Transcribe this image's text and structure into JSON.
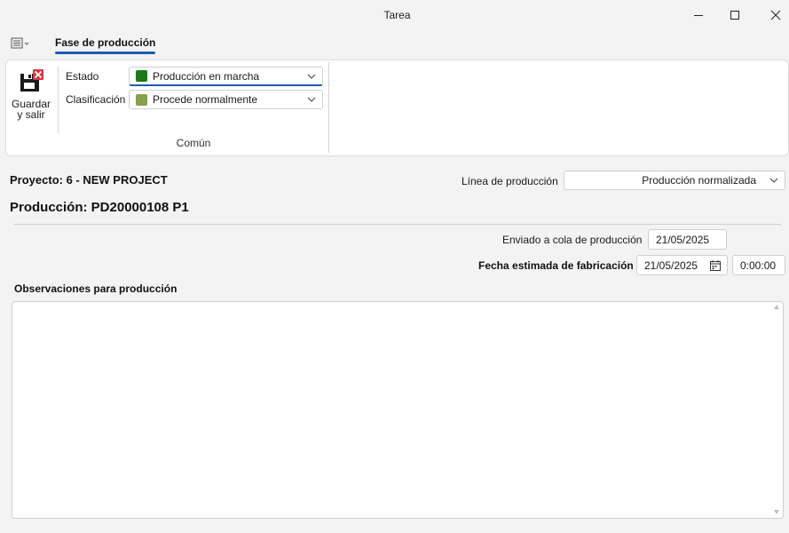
{
  "window": {
    "title": "Tarea"
  },
  "ribbon": {
    "active_tab": "Fase de producción",
    "save_button": {
      "line1": "Guardar",
      "line2": "y salir"
    },
    "estado": {
      "label": "Estado",
      "value": "Producción en marcha",
      "color": "#1a7a1a"
    },
    "clasificacion": {
      "label": "Clasificación",
      "value": "Procede normalmente",
      "color": "#88a04c"
    },
    "group_label": "Común"
  },
  "header": {
    "proyecto": "Proyecto: 6 - NEW PROJECT",
    "produccion": "Producción: PD20000108 P1"
  },
  "linea": {
    "label": "Línea de producción",
    "value": "Producción normalizada"
  },
  "enviado": {
    "label": "Enviado a cola de producción",
    "value": "21/05/2025"
  },
  "fecha_estimada": {
    "label": "Fecha estimada de fabricación",
    "date": "21/05/2025",
    "time": "0:00:00"
  },
  "observaciones": {
    "label": "Observaciones para producción",
    "value": ""
  },
  "colors": {
    "accent": "#1e5bb0",
    "save_red": "#d9363e"
  }
}
